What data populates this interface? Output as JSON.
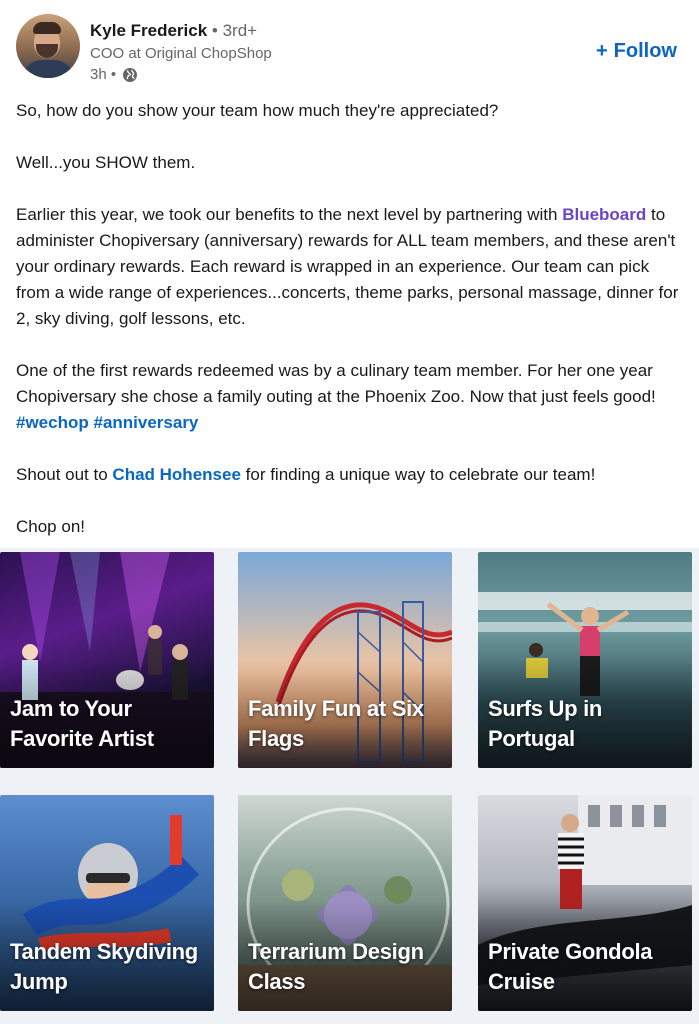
{
  "author": {
    "name": "Kyle Frederick",
    "degree": "• 3rd+",
    "headline": "COO at Original ChopShop",
    "time": "3h •"
  },
  "follow_label": "Follow",
  "post": {
    "p1": "So, how do you show your team how much they're appreciated?",
    "p2": "Well...you SHOW them.",
    "p3_a": "Earlier this year, we took our benefits to the next level by partnering with",
    "p3_mention": "Blueboard",
    "p3_b": "to administer Chopiversary (anniversary) rewards for ALL team members, and these aren't your ordinary rewards. Each reward is wrapped in an experience. Our team can pick from a wide range of experiences...concerts, theme parks, personal massage, dinner for 2, sky diving, golf lessons, etc.",
    "p4_a": "One of the first rewards redeemed was by a culinary team member. For her one year Chopiversary she chose a family outing at the Phoenix Zoo. Now that just feels good!",
    "hashtag1": "#wechop",
    "hashtag2": "#anniversary",
    "p5_a": "Shout out to",
    "p5_mention": "Chad Hohensee",
    "p5_b": "for finding a unique way to celebrate our team!",
    "p6": "Chop on!"
  },
  "tiles": [
    {
      "caption": "Jam to Your Favorite Artist"
    },
    {
      "caption": "Family Fun at Six Flags"
    },
    {
      "caption": "Surfs Up in Portugal"
    },
    {
      "caption": "Tandem Skydiving Jump"
    },
    {
      "caption": "Terrarium Design Class"
    },
    {
      "caption": "Private Gondola Cruise"
    }
  ],
  "colors": {
    "link": "#0a66c2",
    "mention": "#6a45c8",
    "text": "#191919",
    "muted": "#666666"
  }
}
